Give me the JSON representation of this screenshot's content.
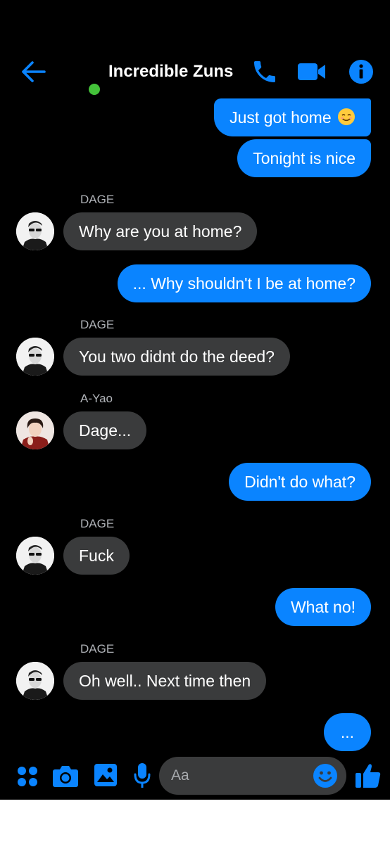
{
  "header": {
    "title": "Incredible Zuns",
    "accent_color": "#0a84ff",
    "online_color": "#44c23a",
    "icons": [
      "back-arrow-icon",
      "phone-icon",
      "video-camera-icon",
      "info-icon"
    ]
  },
  "messages": [
    {
      "side": "out",
      "text": "Just got home",
      "emoji": "smiling-face-emoji"
    },
    {
      "side": "out",
      "text": "Tonight is nice"
    },
    {
      "side": "in",
      "sender": "DAGE",
      "text": "Why are you at home?"
    },
    {
      "side": "out",
      "text": "... Why shouldn't I be at home?"
    },
    {
      "side": "in",
      "sender": "DAGE",
      "text": "You two didnt do the deed?"
    },
    {
      "side": "in",
      "sender": "A-Yao",
      "text": "Dage..."
    },
    {
      "side": "out",
      "text": "Didn't do what?"
    },
    {
      "side": "in",
      "sender": "DAGE",
      "text": "Fuck"
    },
    {
      "side": "out",
      "text": "What no!"
    },
    {
      "side": "in",
      "sender": "DAGE",
      "text": "Oh well.. Next time then"
    },
    {
      "side": "out",
      "text": "..."
    }
  ],
  "composer": {
    "placeholder": "Aa",
    "icons": [
      "apps-grid-icon",
      "camera-icon",
      "gallery-icon",
      "microphone-icon",
      "emoji-icon",
      "thumbs-up-icon"
    ]
  }
}
